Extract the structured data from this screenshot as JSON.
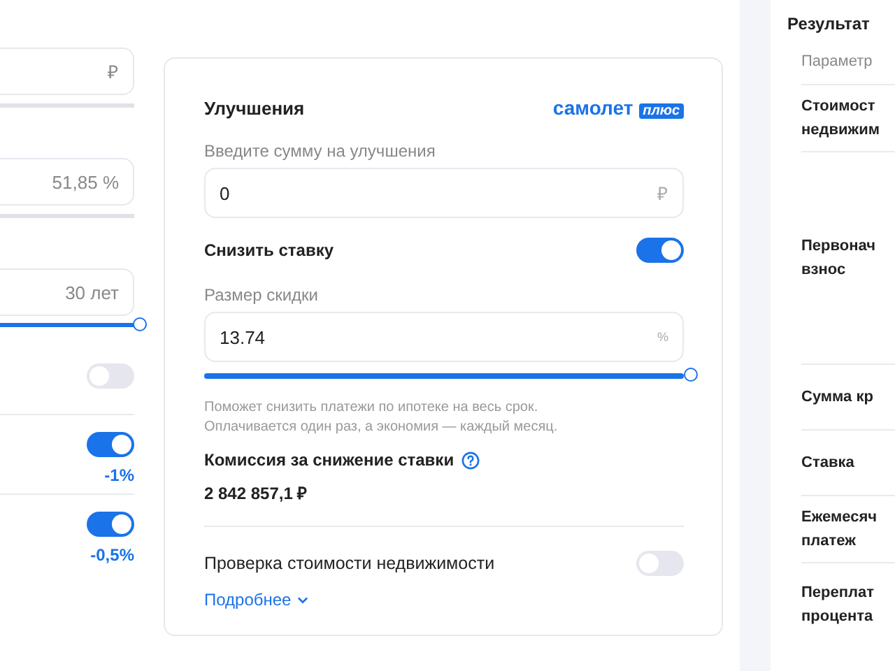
{
  "left_column": {
    "fields": [
      {
        "value": "₽"
      },
      {
        "value": "51,85 %"
      },
      {
        "value": "30 лет",
        "slider": {
          "level": 1
        }
      }
    ],
    "toggles": [
      {
        "on": false
      },
      {
        "on": true,
        "note": "-1%"
      },
      {
        "on": true,
        "note": "-0,5%"
      }
    ]
  },
  "improvements": {
    "title": "Улучшения",
    "brand": "самолет",
    "brand_badge": "плюс",
    "amount_label": "Введите сумму на улучшения",
    "amount_value": "0",
    "amount_unit": "₽",
    "lower_rate_label": "Снизить ставку",
    "lower_rate_on": true,
    "discount_label": "Размер скидки",
    "discount_value": "13.74",
    "discount_unit": "%",
    "discount_slider": {
      "level": 1
    },
    "hint": [
      "Поможет снизить платежи по ипотеке на весь срок.",
      "Оплачивается один раз, а экономия — каждый месяц."
    ],
    "commission_label": "Комиссия за снижение ставки",
    "commission_value": "2 842 857,1 ₽",
    "valuation_label": "Проверка стоимости недвижимости",
    "valuation_on": false,
    "more_link": "Подробнее"
  },
  "results": {
    "title": "Результат",
    "header": "Параметр",
    "rows": [
      {
        "lines": [
          "Стоимост",
          "недвижим"
        ]
      },
      {
        "lines": [
          "Первонач",
          "взнос"
        ]
      },
      {
        "lines": [
          "Сумма кр"
        ]
      },
      {
        "lines": [
          "Ставка"
        ]
      },
      {
        "lines": [
          "Ежемесяч",
          "платеж"
        ]
      },
      {
        "lines": [
          "Переплат",
          "процента"
        ]
      }
    ]
  }
}
